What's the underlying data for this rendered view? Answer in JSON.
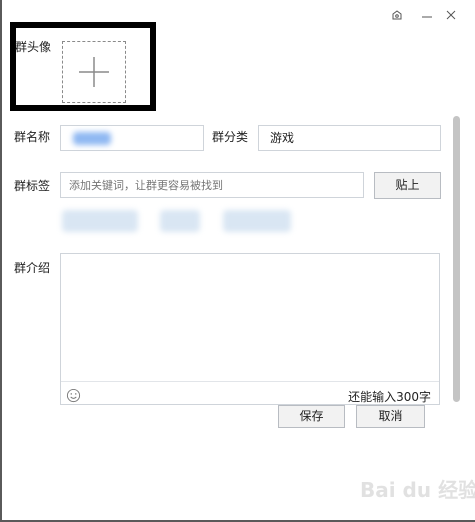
{
  "avatar": {
    "label": "群头像"
  },
  "group_name": {
    "label": "群名称"
  },
  "category": {
    "label": "群分类",
    "value": "游戏"
  },
  "tags": {
    "label": "群标签",
    "placeholder": "添加关键词，让群更容易被找到",
    "paste_label": "贴上"
  },
  "intro": {
    "label": "群介绍",
    "remaining": "还能输入300字"
  },
  "actions": {
    "save_label": "保存",
    "cancel_label": "取消"
  },
  "watermark": {
    "text": "Bai du 经验"
  },
  "colors": {
    "annotation": "#000000",
    "field_border": "#cfd4da",
    "scrollbar": "#c4c4c4"
  }
}
